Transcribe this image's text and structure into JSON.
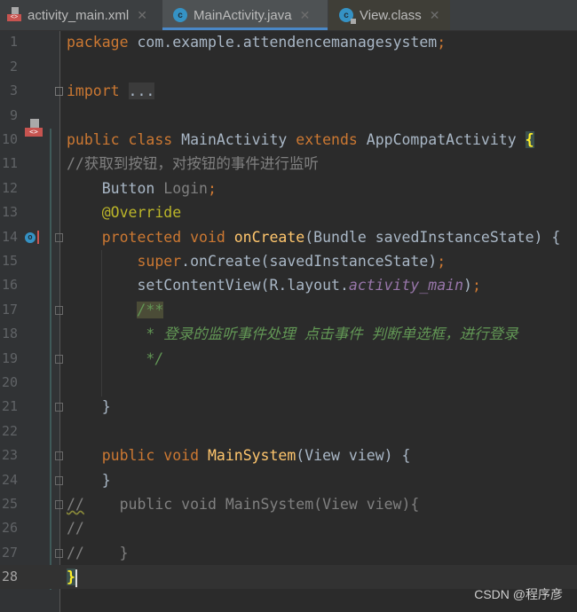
{
  "tabs": [
    {
      "label": "activity_main.xml",
      "icon": "xml-layout-icon",
      "active": false
    },
    {
      "label": "MainActivity.java",
      "icon": "java-class-icon",
      "active": true
    },
    {
      "label": "View.class",
      "icon": "locked-class-icon",
      "active": false
    }
  ],
  "close_glyph": "✕",
  "code": {
    "lines": [
      {
        "n": "1",
        "tokens": [
          {
            "t": "package ",
            "c": "kw"
          },
          {
            "t": "com.example.attendencemanagesystem",
            "c": "tx"
          },
          {
            "t": ";",
            "c": "kw"
          }
        ]
      },
      {
        "n": "2",
        "tokens": []
      },
      {
        "n": "3",
        "tokens": [
          {
            "t": "import ",
            "c": "kw"
          },
          {
            "t": "...",
            "c": "fold"
          }
        ]
      },
      {
        "n": "9",
        "tokens": []
      },
      {
        "n": "10",
        "tokens": [
          {
            "t": "public class ",
            "c": "kw"
          },
          {
            "t": "MainActivity ",
            "c": "tx"
          },
          {
            "t": "extends ",
            "c": "kw"
          },
          {
            "t": "AppCompatActivity ",
            "c": "tx"
          },
          {
            "t": "{",
            "c": "brace-hl"
          }
        ]
      },
      {
        "n": "11",
        "tokens": [
          {
            "t": "//获取到按钮，对按钮的事件进行监听",
            "c": "cm"
          }
        ]
      },
      {
        "n": "12",
        "tokens": [
          {
            "t": "    Button ",
            "c": "tx"
          },
          {
            "t": "Login",
            "c": "un"
          },
          {
            "t": ";",
            "c": "kw"
          }
        ]
      },
      {
        "n": "13",
        "tokens": [
          {
            "t": "    @Override",
            "c": "an"
          }
        ]
      },
      {
        "n": "14",
        "tokens": [
          {
            "t": "    protected void ",
            "c": "kw"
          },
          {
            "t": "onCreate",
            "c": "fn"
          },
          {
            "t": "(Bundle savedInstanceState) {",
            "c": "tx"
          }
        ]
      },
      {
        "n": "15",
        "tokens": [
          {
            "t": "        super",
            "c": "kw"
          },
          {
            "t": ".onCreate(savedInstanceState)",
            "c": "tx"
          },
          {
            "t": ";",
            "c": "kw"
          }
        ]
      },
      {
        "n": "16",
        "tokens": [
          {
            "t": "        setContentView(R.layout.",
            "c": "tx"
          },
          {
            "t": "activity_main",
            "c": "st"
          },
          {
            "t": ")",
            "c": "tx"
          },
          {
            "t": ";",
            "c": "kw"
          }
        ]
      },
      {
        "n": "17",
        "tokens": [
          {
            "t": "        ",
            "c": "tx"
          },
          {
            "t": "/**",
            "c": "dc doc-hl"
          }
        ]
      },
      {
        "n": "18",
        "tokens": [
          {
            "t": "         * 登录的监听事件处理 点击事件 判断单选框，进行登录",
            "c": "dc"
          }
        ]
      },
      {
        "n": "19",
        "tokens": [
          {
            "t": "         */",
            "c": "dc"
          }
        ]
      },
      {
        "n": "20",
        "tokens": []
      },
      {
        "n": "21",
        "tokens": [
          {
            "t": "    }",
            "c": "tx"
          }
        ]
      },
      {
        "n": "22",
        "tokens": []
      },
      {
        "n": "23",
        "tokens": [
          {
            "t": "    public void ",
            "c": "kw"
          },
          {
            "t": "MainSystem",
            "c": "fn"
          },
          {
            "t": "(View view) {",
            "c": "tx"
          }
        ]
      },
      {
        "n": "24",
        "tokens": [
          {
            "t": "    }",
            "c": "tx"
          }
        ]
      },
      {
        "n": "25",
        "tokens": [
          {
            "t": "//",
            "c": "cm wavy"
          },
          {
            "t": "    public void MainSystem(View view){",
            "c": "cm"
          }
        ]
      },
      {
        "n": "26",
        "tokens": [
          {
            "t": "//",
            "c": "cm"
          }
        ]
      },
      {
        "n": "27",
        "tokens": [
          {
            "t": "//    }",
            "c": "cm"
          }
        ]
      },
      {
        "n": "28",
        "tokens": [
          {
            "t": "}",
            "c": "brace-hl"
          }
        ],
        "current": true
      }
    ]
  },
  "gutter_icons": {
    "10": "xml-layout-icon",
    "14": "override-method-icon"
  },
  "fold_markers": {
    "3": "expand",
    "14": "open",
    "17": "open",
    "19": "close",
    "21": "close",
    "23": "open",
    "24": "close",
    "25": "open",
    "27": "close"
  },
  "watermark": "CSDN @程序彦",
  "colors": {
    "keyword": "#cc7832",
    "text": "#a9b7c6",
    "comment": "#808080",
    "doc_comment": "#629755",
    "annotation": "#bbb529",
    "method": "#ffc66d",
    "static_field": "#9876aa",
    "tab_accent": "#4a88c7"
  }
}
